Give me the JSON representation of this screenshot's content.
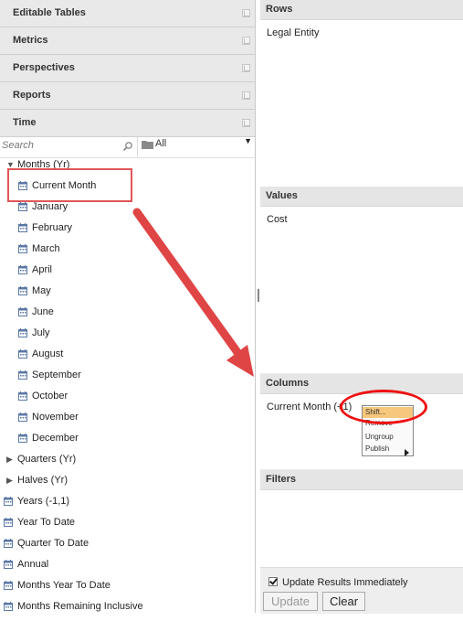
{
  "left_sections": [
    {
      "label": "Editable Tables"
    },
    {
      "label": "Metrics"
    },
    {
      "label": "Perspectives"
    },
    {
      "label": "Reports"
    },
    {
      "label": "Time"
    }
  ],
  "search": {
    "placeholder": "Search",
    "filter_value": "All"
  },
  "tree": {
    "months_group": "Months (Yr)",
    "months": [
      "Current Month",
      "January",
      "February",
      "March",
      "April",
      "May",
      "June",
      "July",
      "August",
      "September",
      "October",
      "November",
      "December"
    ],
    "groups": [
      "Quarters (Yr)",
      "Halves (Yr)"
    ],
    "others": [
      "Years (-1,1)",
      "Year To Date",
      "Quarter To Date",
      "Annual",
      "Months Year To Date",
      "Months Remaining Inclusive"
    ]
  },
  "panes": {
    "rows": {
      "title": "Rows",
      "item": "Legal Entity"
    },
    "values": {
      "title": "Values",
      "item": "Cost"
    },
    "columns": {
      "title": "Columns",
      "item": "Current Month (+1)"
    },
    "filters": {
      "title": "Filters"
    }
  },
  "context_menu": {
    "items": [
      "Shift...",
      "Remove",
      "Ungroup",
      "Publish"
    ]
  },
  "footer": {
    "checkbox_label": "Update Results Immediately",
    "update_label": "Update",
    "clear_label": "Clear"
  },
  "colors": {
    "highlight": "#e05555",
    "menu_highlight": "#f6c77c"
  }
}
